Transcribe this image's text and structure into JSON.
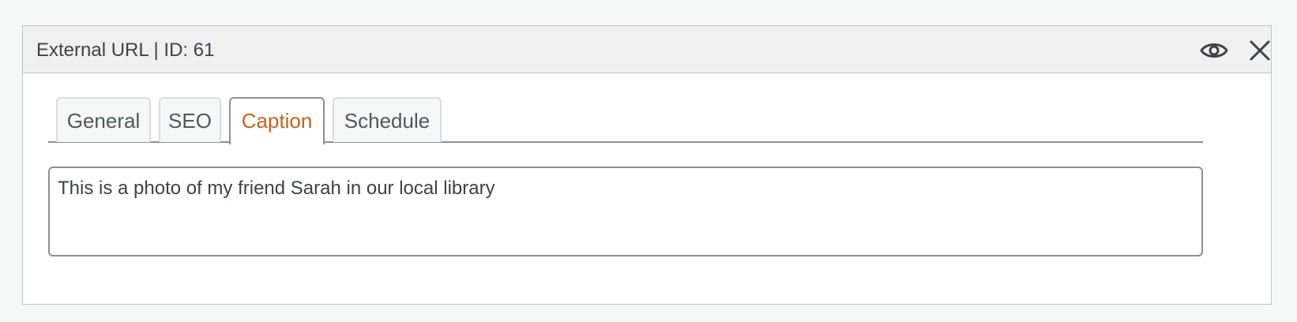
{
  "panel": {
    "title": "External URL | ID: 61",
    "actions": [
      {
        "name": "view",
        "icon": "eye-icon"
      },
      {
        "name": "close",
        "icon": "close-icon"
      }
    ]
  },
  "tabs": [
    {
      "label": "General",
      "active": false
    },
    {
      "label": "SEO",
      "active": false
    },
    {
      "label": "Caption",
      "active": true
    },
    {
      "label": "Schedule",
      "active": false
    }
  ],
  "caption": {
    "value": "This is a photo of my friend Sarah in our local library"
  },
  "colors": {
    "active_tab": "#c9621e",
    "border": "#8c8f94",
    "header_bg": "#f0f0f1",
    "text": "#3c434a"
  }
}
